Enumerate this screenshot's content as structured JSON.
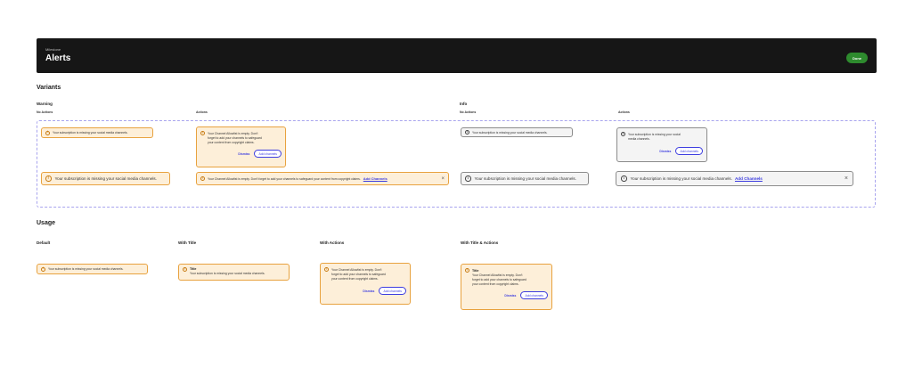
{
  "header": {
    "eyebrow": "Milestone",
    "title": "Alerts",
    "done_label": "Done"
  },
  "variants": {
    "heading": "Variants",
    "warning": {
      "heading": "Warning"
    },
    "info": {
      "heading": "Info"
    },
    "no_actions_label": "No Actions",
    "actions_label": "Actions"
  },
  "messages": {
    "missing": "Your subscription is missing your social media channels.",
    "allowlist_long": "Your Channel Allowlist is empty. Don't forget to add your channels to safeguard your content from copyright claims.",
    "allowlist_line1": "Your Channel Allowlist is empty. Don't",
    "allowlist_line2": "forget to add your channels to safeguard",
    "allowlist_line3": "your content from copyright claims.",
    "info_line1": "Your subscription is missing your social",
    "info_line2": "media channels."
  },
  "actions": {
    "dismiss": "Dismiss",
    "add_channels": "Add channels",
    "add_channels_link": "Add Channels"
  },
  "icons": {
    "warning": "warning-circle-icon",
    "info": "info-circle-icon",
    "close": "close-icon"
  },
  "usage": {
    "heading": "Usage",
    "default_label": "Default",
    "with_title_label": "With Title",
    "with_actions_label": "With Actions",
    "with_title_actions_label": "With Title & Actions",
    "alert_title": "Title"
  },
  "colors": {
    "header_bg": "#161616",
    "done_button": "#2e8b2e",
    "warning_bg": "#fdefd9",
    "warning_border": "#e8a23f",
    "info_bg": "#f4f4f4",
    "info_border": "#8c8c8c",
    "link": "#3d3de0",
    "dashed_border": "#a8a4ee"
  }
}
